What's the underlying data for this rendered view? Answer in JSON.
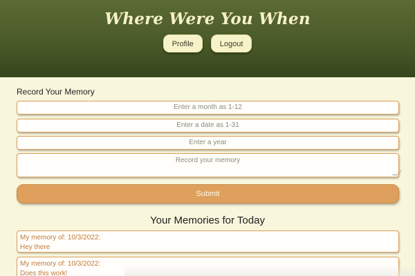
{
  "header": {
    "title": "Where Were You When",
    "nav": [
      {
        "label": "Profile"
      },
      {
        "label": "Logout"
      }
    ]
  },
  "form": {
    "section_label": "Record Your Memory",
    "month_placeholder": "Enter a month as 1-12",
    "date_placeholder": "Enter a date as 1-31",
    "year_placeholder": "Enter a year",
    "memory_placeholder": "Record your memory",
    "submit_label": "Submit"
  },
  "memories": {
    "heading": "Your Memories for Today",
    "items": [
      {
        "label": "My memory of: 10/3/2022:",
        "text": "Hey there"
      },
      {
        "label": "My memory of: 10/3/2022:",
        "text": "Does this work!"
      }
    ]
  },
  "colors": {
    "header_bg": "#4a5a28",
    "page_bg": "#f8f6dc",
    "accent": "#dea05c",
    "field_border": "#d99b58",
    "memory_text": "#c07a3a"
  }
}
